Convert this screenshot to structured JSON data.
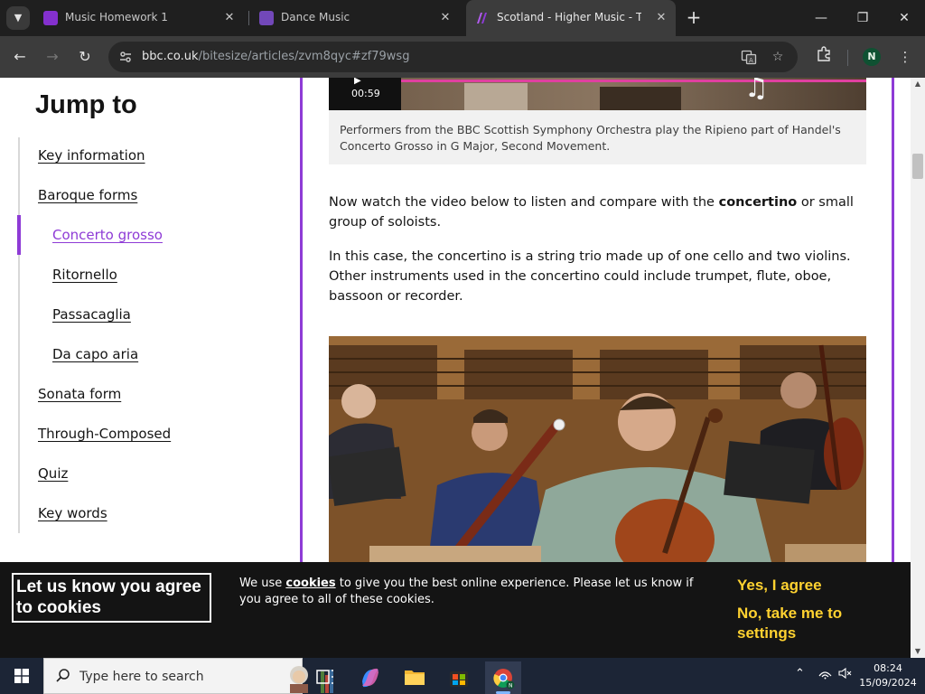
{
  "browser": {
    "tabs": [
      {
        "title": "Music Homework 1",
        "favicon_color": "#8430ce",
        "active": false
      },
      {
        "title": "Dance Music",
        "favicon_color": "#7248b9",
        "active": false
      },
      {
        "title": "Scotland - Higher Music - Textu",
        "favicon_color": "#8e3bd6",
        "active": true
      }
    ],
    "new_tab_label": "+",
    "url_domain": "bbc.co.uk",
    "url_path": "/bitesize/articles/zvm8qyc#zf79wsg",
    "profile_initial": "N"
  },
  "sidebar": {
    "title": "Jump to",
    "items": [
      {
        "label": "Key information",
        "level": "top",
        "active": false
      },
      {
        "label": "Baroque forms",
        "level": "top",
        "active": false
      },
      {
        "label": "Concerto grosso",
        "level": "sub",
        "active": true
      },
      {
        "label": "Ritornello",
        "level": "sub",
        "active": false
      },
      {
        "label": "Passacaglia",
        "level": "sub",
        "active": false
      },
      {
        "label": "Da capo aria",
        "level": "sub",
        "active": false
      },
      {
        "label": "Sonata form",
        "level": "top",
        "active": false
      },
      {
        "label": "Through-Composed",
        "level": "top",
        "active": false
      },
      {
        "label": "Quiz",
        "level": "top",
        "active": false
      },
      {
        "label": "Key words",
        "level": "top",
        "active": false
      }
    ]
  },
  "article": {
    "video1_duration": "00:59",
    "video1_caption": "Performers from the BBC Scottish Symphony Orchestra play the Ripieno part of Handel's Concerto Grosso in G Major, Second Movement.",
    "para1_before": "Now watch the video below to listen and compare with the ",
    "para1_bold": "concertino",
    "para1_after": " or small group of soloists.",
    "para2": "In this case, the concertino is a string trio made up of one cello and two violins. Other instruments used in the concertino could include trumpet, flute, oboe, bassoon or recorder."
  },
  "cookie_banner": {
    "title": "Let us know you agree to cookies",
    "text_before": "We use ",
    "text_link": "cookies",
    "text_after": " to give you the best online experience. Please let us know if you agree to all of these cookies.",
    "agree_label": "Yes, I agree",
    "settings_label": "No, take me to settings"
  },
  "taskbar": {
    "search_placeholder": "Type here to search",
    "time": "08:24",
    "date": "15/09/2024"
  },
  "colors": {
    "accent_purple": "#8e3bd6",
    "cookie_cta": "#ffd230"
  }
}
